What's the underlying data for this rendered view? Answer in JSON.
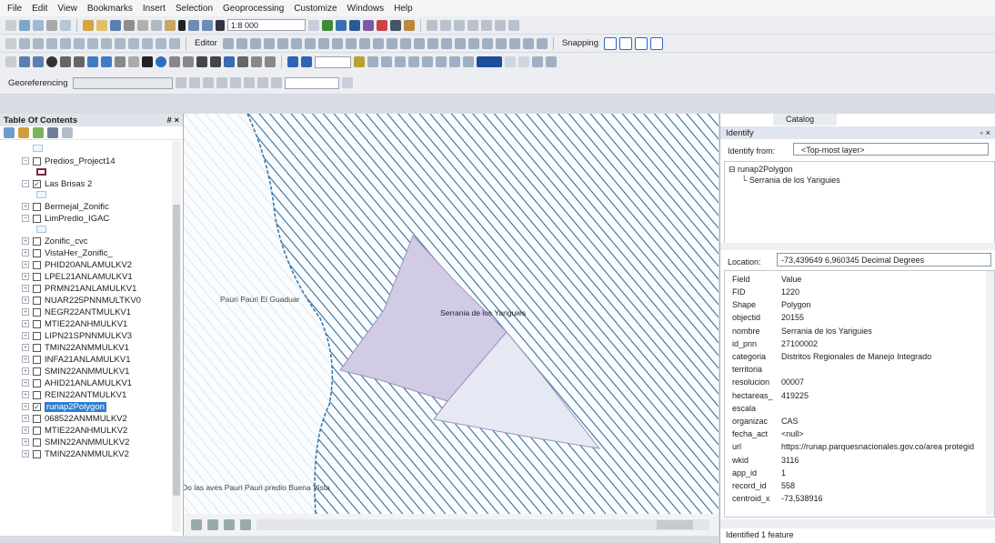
{
  "menu": [
    "File",
    "Edit",
    "View",
    "Bookmarks",
    "Insert",
    "Selection",
    "Geoprocessing",
    "Customize",
    "Windows",
    "Help"
  ],
  "toolbar": {
    "scale": "1:8 000",
    "editor_label": "Editor",
    "snapping_label": "Snapping",
    "georeferencing_label": "Georeferencing"
  },
  "toc": {
    "title": "Table Of Contents",
    "pin": "# ×",
    "layers": [
      {
        "name": "Predios_Project14",
        "checked": false,
        "selected": false
      },
      {
        "name": "Las Brisas 2",
        "checked": true,
        "selected": false
      },
      {
        "name": "Bermejal_Zonific",
        "checked": false,
        "selected": false
      },
      {
        "name": "LimPredio_IGAC",
        "checked": false,
        "selected": false
      },
      {
        "name": "Zonific_cvc",
        "checked": false,
        "selected": false
      },
      {
        "name": "VistaHer_Zonific_",
        "checked": false,
        "selected": false
      },
      {
        "name": "PHID20ANLAMULKV2",
        "checked": false,
        "selected": false
      },
      {
        "name": "LPEL21ANLAMULKV1",
        "checked": false,
        "selected": false
      },
      {
        "name": "PRMN21ANLAMULKV1",
        "checked": false,
        "selected": false
      },
      {
        "name": "NUAR225PNNMULTKV0",
        "checked": false,
        "selected": false
      },
      {
        "name": "NEGR22ANTMULKV1",
        "checked": false,
        "selected": false
      },
      {
        "name": "MTIE22ANHMULKV1",
        "checked": false,
        "selected": false
      },
      {
        "name": "LIPN21SPNNMULKV3",
        "checked": false,
        "selected": false
      },
      {
        "name": "TMIN22ANMMULKV1",
        "checked": false,
        "selected": false
      },
      {
        "name": "INFA21ANLAMULKV1",
        "checked": false,
        "selected": false
      },
      {
        "name": "SMIN22ANMMULKV1",
        "checked": false,
        "selected": false
      },
      {
        "name": "AHID21ANLAMULKV1",
        "checked": false,
        "selected": false
      },
      {
        "name": "REIN22ANTMULKV1",
        "checked": false,
        "selected": false
      },
      {
        "name": "runap2Polygon",
        "checked": true,
        "selected": true
      },
      {
        "name": "068522ANMMULKV2",
        "checked": false,
        "selected": false
      },
      {
        "name": "MTIE22ANHMULKV2",
        "checked": false,
        "selected": false
      },
      {
        "name": "SMIN22ANMMULKV2",
        "checked": false,
        "selected": false
      },
      {
        "name": "TMIN22ANMMULKV2",
        "checked": false,
        "selected": false
      }
    ]
  },
  "map": {
    "label_serrania": "Serrania de los Yariguies",
    "label_left": "Pauri Pauri El Guaduar",
    "label_bottom": "Do las aves Pauri Pauri predio Buena Vista"
  },
  "identify": {
    "catalog_tab": "Catalog",
    "title": "Identify",
    "identify_from_label": "Identify from:",
    "identify_from_value": "<Top-most layer>",
    "tree_layer": "runap2Polygon",
    "tree_feature": "Serrania de los Yariguies",
    "location_label": "Location:",
    "location_value": "-73,439649  6,960345 Decimal Degrees",
    "field_header": "Field",
    "value_header": "Value",
    "fields": [
      {
        "f": "FID",
        "v": "1220"
      },
      {
        "f": "Shape",
        "v": "Polygon"
      },
      {
        "f": "objectid",
        "v": "20155"
      },
      {
        "f": "nombre",
        "v": "Serrania de los Yariguies"
      },
      {
        "f": "id_pnn",
        "v": "27100002"
      },
      {
        "f": "categoria",
        "v": "Distritos Regionales de Manejo Integrado"
      },
      {
        "f": "territoria",
        "v": ""
      },
      {
        "f": "resolucion",
        "v": "00007"
      },
      {
        "f": "hectareas_",
        "v": "419225"
      },
      {
        "f": "escala",
        "v": ""
      },
      {
        "f": "organizac",
        "v": "CAS"
      },
      {
        "f": "fecha_act",
        "v": "<null>"
      },
      {
        "f": "url",
        "v": "https://runap.parquesnacionales.gov.co/area protegid"
      },
      {
        "f": "wkid",
        "v": "3116"
      },
      {
        "f": "app_id",
        "v": "1"
      },
      {
        "f": "record_id",
        "v": "558"
      },
      {
        "f": "centroid_x",
        "v": "-73,538916"
      }
    ],
    "status": "Identified 1 feature"
  },
  "colors": {
    "hatch": "#2f6f9e",
    "polygon_purple": "#d2cbe6",
    "polygon_light": "#e6e9f3",
    "selection_blue": "#2f7fd1"
  }
}
